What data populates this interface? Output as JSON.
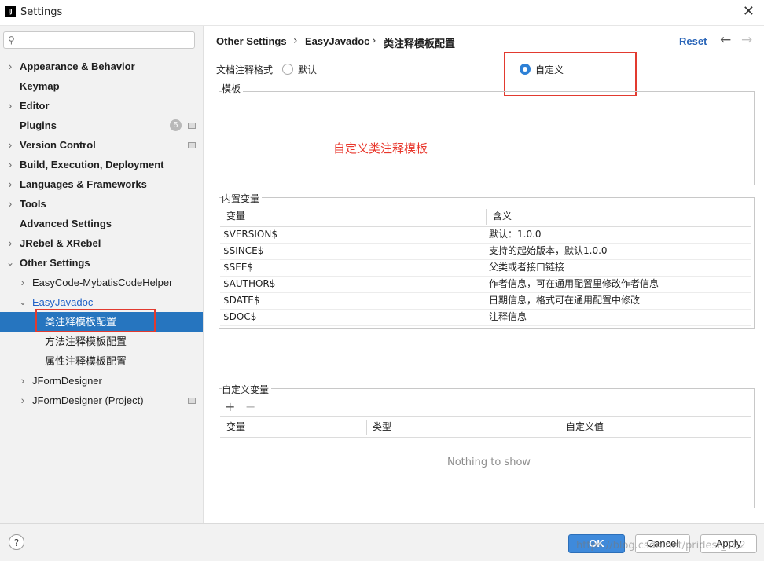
{
  "window": {
    "title": "Settings",
    "app_icon_text": "IJ"
  },
  "search": {
    "placeholder": ""
  },
  "sidebar": {
    "items": [
      {
        "label": "Appearance & Behavior",
        "expandable": true
      },
      {
        "label": "Keymap"
      },
      {
        "label": "Editor",
        "expandable": true
      },
      {
        "label": "Plugins",
        "badge": "5"
      },
      {
        "label": "Version Control",
        "expandable": true
      },
      {
        "label": "Build, Execution, Deployment",
        "expandable": true
      },
      {
        "label": "Languages & Frameworks",
        "expandable": true
      },
      {
        "label": "Tools",
        "expandable": true
      },
      {
        "label": "Advanced Settings"
      },
      {
        "label": "JRebel & XRebel",
        "expandable": true
      },
      {
        "label": "Other Settings",
        "expanded": true
      },
      {
        "label": "EasyCode-MybatisCodeHelper",
        "expandable": true
      },
      {
        "label": "EasyJavadoc",
        "expanded": true
      },
      {
        "label": "类注释模板配置",
        "selected": true
      },
      {
        "label": "方法注释模板配置"
      },
      {
        "label": "属性注释模板配置"
      },
      {
        "label": "JFormDesigner",
        "expandable": true
      },
      {
        "label": "JFormDesigner (Project)",
        "expandable": true
      }
    ]
  },
  "header": {
    "breadcrumb": [
      "Other Settings",
      "EasyJavadoc",
      "类注释模板配置"
    ],
    "reset_label": "Reset"
  },
  "format": {
    "label": "文档注释格式",
    "options": [
      {
        "label": "默认",
        "checked": false
      },
      {
        "label": "自定义",
        "checked": true
      }
    ]
  },
  "template": {
    "group_title": "模板",
    "content": "自定义类注释模板"
  },
  "builtin_vars": {
    "group_title": "内置变量",
    "columns": [
      "变量",
      "含义"
    ],
    "rows": [
      [
        "$VERSION$",
        "默认：1.0.0"
      ],
      [
        "$SINCE$",
        "支持的起始版本，默认1.0.0"
      ],
      [
        "$SEE$",
        "父类或者接口链接"
      ],
      [
        "$AUTHOR$",
        "作者信息，可在通用配置里修改作者信息"
      ],
      [
        "$DATE$",
        "日期信息，格式可在通用配置中修改"
      ],
      [
        "$DOC$",
        "注释信息"
      ]
    ]
  },
  "custom_vars": {
    "group_title": "自定义变量",
    "add_symbol": "+",
    "remove_symbol": "−",
    "columns": [
      "变量",
      "类型",
      "自定义值"
    ],
    "empty_text": "Nothing to show"
  },
  "footer": {
    "help_label": "?",
    "ok_label": "OK",
    "cancel_label": "Cancel",
    "apply_label": "Apply",
    "watermark": "https://blog.csdn.net/pridest_122"
  },
  "colors": {
    "accent": "#2675bf",
    "annotation_red": "#e23a2f",
    "link_blue": "#2263c7"
  }
}
